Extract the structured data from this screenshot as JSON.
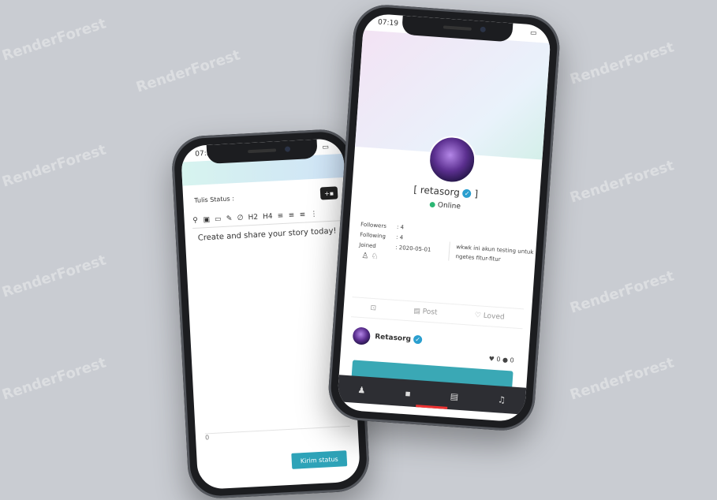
{
  "left_phone": {
    "status_time": "07:24",
    "editor_label": "Tulis Status :",
    "toolbar": [
      "H2",
      "H4"
    ],
    "placeholder": "Create and share your story today!",
    "footer_counter": "0",
    "submit_label": "Kirim status"
  },
  "right_phone": {
    "status_time": "07:19",
    "username": "[ retasorg",
    "username_close": "]",
    "online": "Online",
    "stats": [
      {
        "label": "Followers",
        "value": "4"
      },
      {
        "label": "Following",
        "value": "4"
      },
      {
        "label": "Joined",
        "value": "2020-05-01"
      }
    ],
    "bio": "wkwk ini akun testing untuk ngetes fitur-fitur",
    "tabs": [
      "Post",
      "Loved"
    ],
    "post_author": "Retasorg",
    "post_likes": "0",
    "post_comments": "0"
  }
}
